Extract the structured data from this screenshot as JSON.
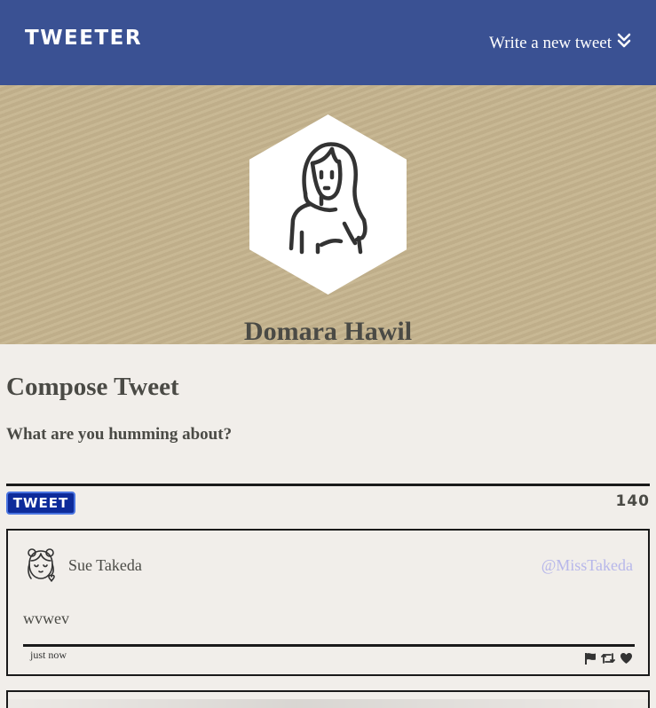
{
  "nav": {
    "brand": "TWEETER",
    "write_link": "Write a new tweet",
    "write_icon": "double-chevron-down-icon"
  },
  "profile": {
    "name": "Domara Hawil",
    "avatar_icon": "woman-avatar-icon",
    "banner_color": "#c5b48e"
  },
  "compose": {
    "title": "Compose Tweet",
    "placeholder": "What are you humming about?",
    "tweet_button": "TWEET",
    "counter": "140"
  },
  "tweets": [
    {
      "author": "Sue Takeda",
      "handle": "@MissTakeda",
      "content": "wvwev",
      "time": "just now",
      "avatar_icon": "girl-avatar-icon",
      "actions": [
        "flag-icon",
        "retweet-icon",
        "heart-icon"
      ]
    }
  ],
  "colors": {
    "navbar": "#3a5193",
    "background": "#f1eeea",
    "tweet_button": "#0d2b9a",
    "handle": "#b7b7ea",
    "text": "#4a4a45"
  }
}
